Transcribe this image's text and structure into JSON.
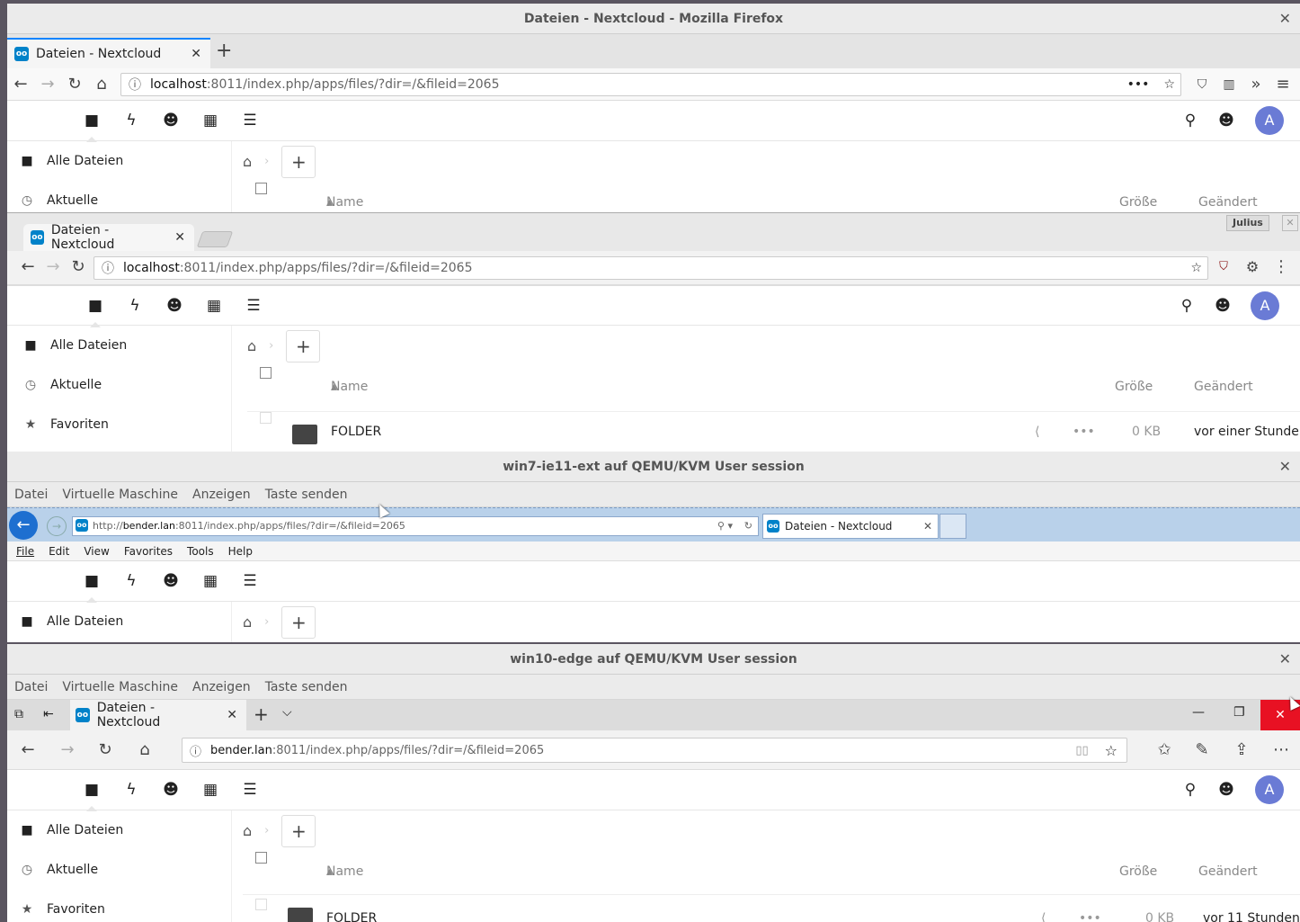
{
  "windows": {
    "firefox": {
      "title": "Dateien - Nextcloud - Mozilla Firefox",
      "tab_title": "Dateien - Nextcloud",
      "url_host": "localhost",
      "url_rest": ":8011/index.php/apps/files/?dir=/&fileid=2065"
    },
    "chromium": {
      "tab_title": "Dateien - Nextcloud",
      "profile_label": "Julius",
      "url_host": "localhost",
      "url_rest": ":8011/index.php/apps/files/?dir=/&fileid=2065"
    },
    "win7": {
      "title": "win7-ie11-ext auf QEMU/KVM User session",
      "url_prefix": "http://",
      "url_host": "bender.lan",
      "url_rest": ":8011/index.php/apps/files/?dir=/&fileid=2065",
      "tab_title": "Dateien - Nextcloud",
      "ie_menu": [
        "File",
        "Edit",
        "View",
        "Favorites",
        "Tools",
        "Help"
      ]
    },
    "win10": {
      "title": "win10-edge auf QEMU/KVM User session",
      "tab_title": "Dateien - Nextcloud",
      "url_host": "bender.lan",
      "url_rest": ":8011/index.php/apps/files/?dir=/&fileid=2065"
    }
  },
  "vm_menu": [
    "Datei",
    "Virtuelle Maschine",
    "Anzeigen",
    "Taste senden"
  ],
  "nextcloud": {
    "avatar_letter": "A",
    "nav": {
      "all_files": "Alle Dateien",
      "recent": "Aktuelle",
      "favorites": "Favoriten"
    },
    "columns": {
      "name": "Name",
      "size": "Größe",
      "modified": "Geändert"
    },
    "files_chromium": [
      {
        "name": "FOLDER",
        "size": "0 KB",
        "modified": "vor einer Stunde"
      }
    ],
    "files_edge": [
      {
        "name": "FOLDER",
        "size": "0 KB",
        "modified": "vor 11 Stunden"
      }
    ]
  },
  "icons": [
    "files-icon",
    "activity-icon",
    "contacts-icon",
    "calendar-icon",
    "deck-icon",
    "search-icon",
    "contacts-menu-icon"
  ]
}
